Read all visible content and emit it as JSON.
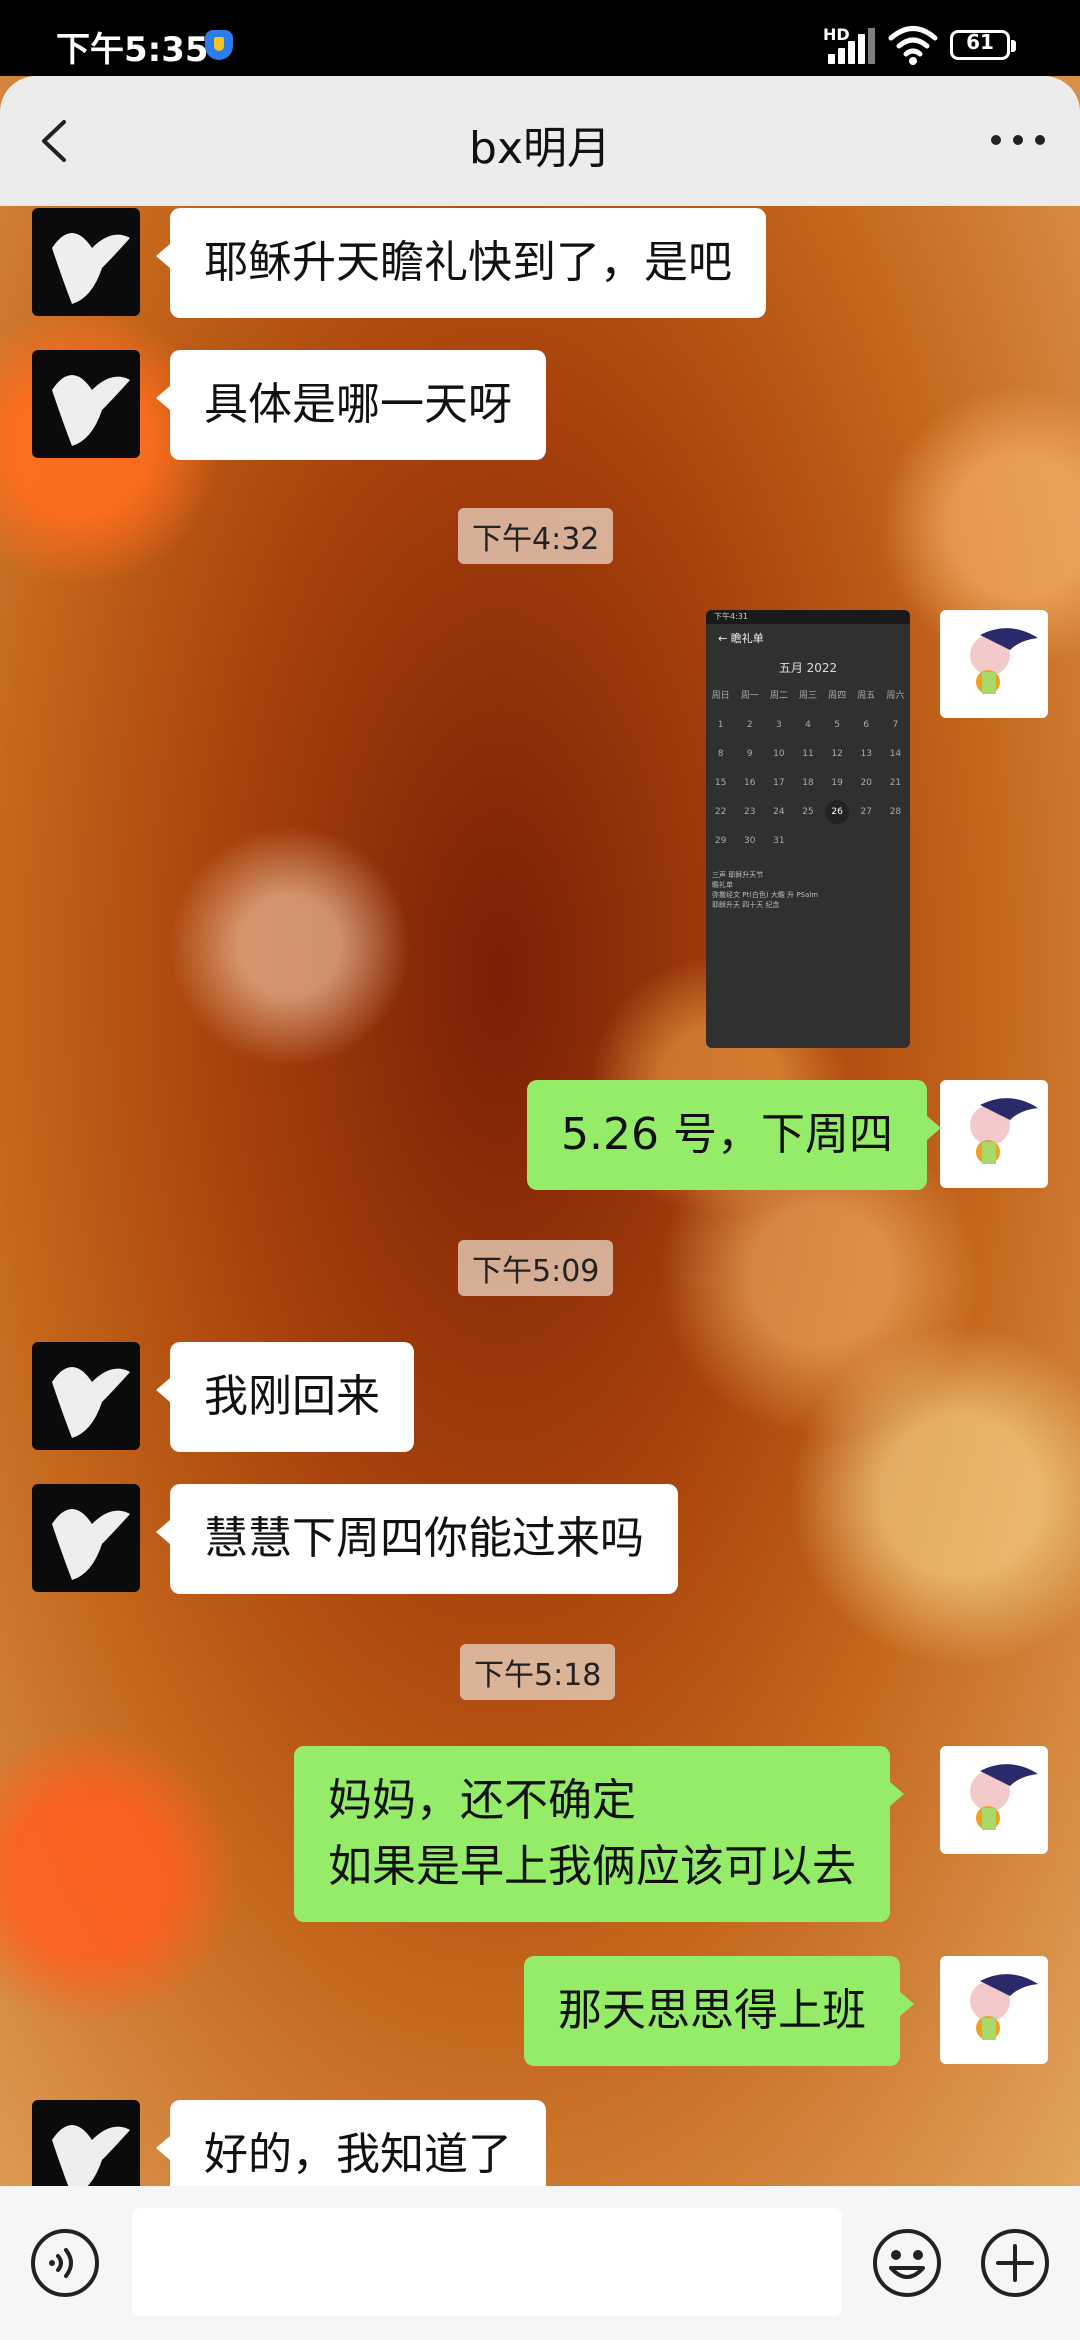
{
  "status": {
    "time": "下午5:35",
    "network": "HD",
    "battery": "61"
  },
  "nav": {
    "title": "bx明月",
    "back_icon": "chevron-left-icon",
    "more_icon": "more-dots-icon"
  },
  "messages": [
    {
      "side": "in",
      "text": "耶稣升天瞻礼快到了，是吧"
    },
    {
      "side": "in",
      "text": "具体是哪一天呀"
    },
    {
      "timestamp": "下午4:32"
    },
    {
      "side": "out",
      "type": "image",
      "image": {
        "status_time": "下午4:31",
        "header": "瞻礼单",
        "month": "五月 2022",
        "weekdays": [
          "周日",
          "周一",
          "周二",
          "周三",
          "周四",
          "周五",
          "周六"
        ],
        "weeks": [
          [
            "1",
            "2",
            "3",
            "4",
            "5",
            "6",
            "7"
          ],
          [
            "8",
            "9",
            "10",
            "11",
            "12",
            "13",
            "14"
          ],
          [
            "15",
            "16",
            "17",
            "18",
            "19",
            "20",
            "21"
          ],
          [
            "22",
            "23",
            "24",
            "25",
            "26",
            "27",
            "28"
          ],
          [
            "29",
            "30",
            "31",
            "",
            "",
            "",
            "",
            ""
          ]
        ],
        "selected_day": "26",
        "note_lines": [
          "三声 耶稣升天节",
          "瞻礼单",
          "弥撒经文 Pt(白色) 大瞻 升 PSalm",
          "耶稣升天 四十天 纪念"
        ]
      }
    },
    {
      "side": "out",
      "text": "5.26 号，下周四"
    },
    {
      "timestamp": "下午5:09"
    },
    {
      "side": "in",
      "text": "我刚回来"
    },
    {
      "side": "in",
      "text": "慧慧下周四你能过来吗"
    },
    {
      "timestamp": "下午5:18"
    },
    {
      "side": "out",
      "lines": [
        "妈妈，还不确定",
        "如果是早上我俩应该可以去"
      ]
    },
    {
      "side": "out",
      "text": "那天思思得上班"
    },
    {
      "side": "in",
      "text": "好的，我知道了"
    }
  ],
  "bottom": {
    "voice_icon": "voice-icon",
    "emoji_icon": "emoji-icon",
    "plus_icon": "plus-icon"
  },
  "colors": {
    "outgoing_bubble": "#95ec69",
    "incoming_bubble": "#ffffff",
    "navbar": "#ececec"
  }
}
